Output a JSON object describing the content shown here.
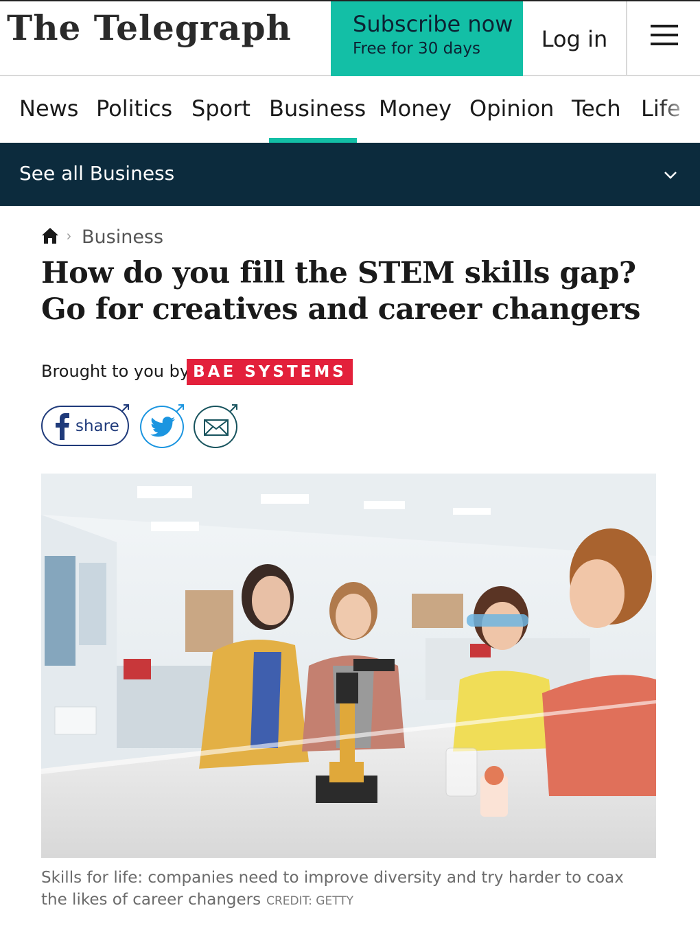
{
  "header": {
    "logo": "The Telegraph",
    "subscribe_main": "Subscribe now",
    "subscribe_sub": "Free for 30 days",
    "login_label": "Log in",
    "menu_icon": "hamburger-icon"
  },
  "nav": {
    "items": [
      {
        "label": "News"
      },
      {
        "label": "Politics"
      },
      {
        "label": "Sport"
      },
      {
        "label": "Business",
        "active": true
      },
      {
        "label": "Money"
      },
      {
        "label": "Opinion"
      },
      {
        "label": "Tech"
      },
      {
        "label": "Life"
      }
    ],
    "accent_color": "#13bfa6"
  },
  "section_bar": {
    "label": "See all Business",
    "icon": "chevron-down-icon"
  },
  "breadcrumb": {
    "home_icon": "home-icon",
    "separator": "›",
    "section": "Business"
  },
  "article": {
    "headline": "How do you fill the STEM skills gap? Go for creatives and career changers",
    "brought_by": "Brought to you by",
    "sponsor": "BAE SYSTEMS",
    "sponsor_color": "#e3203b",
    "share": {
      "facebook_label": "share",
      "twitter_icon": "twitter-icon",
      "email_icon": "email-icon"
    },
    "image_caption": "Skills for life: companies need to improve diversity and try harder to coax the likes of career changers",
    "image_credit": "Credit: Getty"
  }
}
